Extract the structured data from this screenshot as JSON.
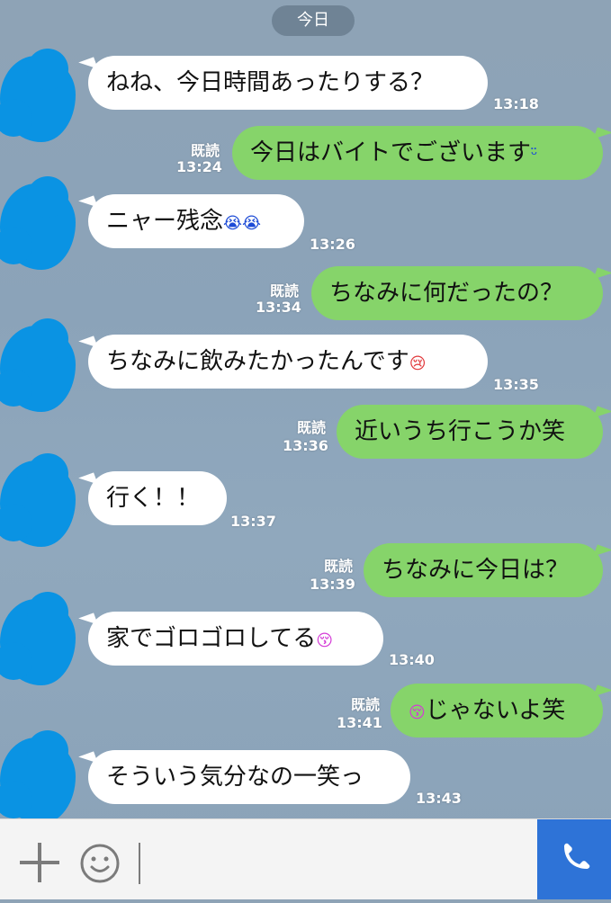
{
  "date_label": "今日",
  "read_label": "既読",
  "messages": [
    {
      "side": "in",
      "text": "ねね、今日時間あったりする？",
      "time": "13:18"
    },
    {
      "side": "out",
      "text": "今日はバイトでございます",
      "emoji": "ᵕ̈",
      "time": "13:24",
      "read": "既読"
    },
    {
      "side": "in",
      "text": "ニャー残念",
      "emoji": "😭😭",
      "time": "13:26"
    },
    {
      "side": "out",
      "text": "ちなみに何だったの？",
      "time": "13:34",
      "read": "既読"
    },
    {
      "side": "in",
      "text": "ちなみに飲みたかったんです",
      "emoji": "😢",
      "time": "13:35"
    },
    {
      "side": "out",
      "text": "近いうち行こうか笑",
      "time": "13:36",
      "read": "既読"
    },
    {
      "side": "in",
      "text": "行く！！",
      "time": "13:37"
    },
    {
      "side": "out",
      "text": "ちなみに今日は？",
      "time": "13:39",
      "read": "既読"
    },
    {
      "side": "in",
      "text": "家でゴロゴロしてる",
      "emoji": "😚",
      "time": "13:40"
    },
    {
      "side": "out",
      "text": "じゃないよ笑",
      "emoji_before": "😚",
      "time": "13:41",
      "read": "既読"
    },
    {
      "side": "in",
      "text": "そういう気分なの一笑っ",
      "time": "13:43"
    }
  ],
  "icons": {
    "plus": "plus-icon",
    "sticker": "smiley-icon",
    "call": "phone-icon"
  },
  "colors": {
    "incoming_bubble": "#ffffff",
    "outgoing_bubble": "#86d46a",
    "call_button": "#2e73d7",
    "avatar_blob": "#0a93e3"
  }
}
